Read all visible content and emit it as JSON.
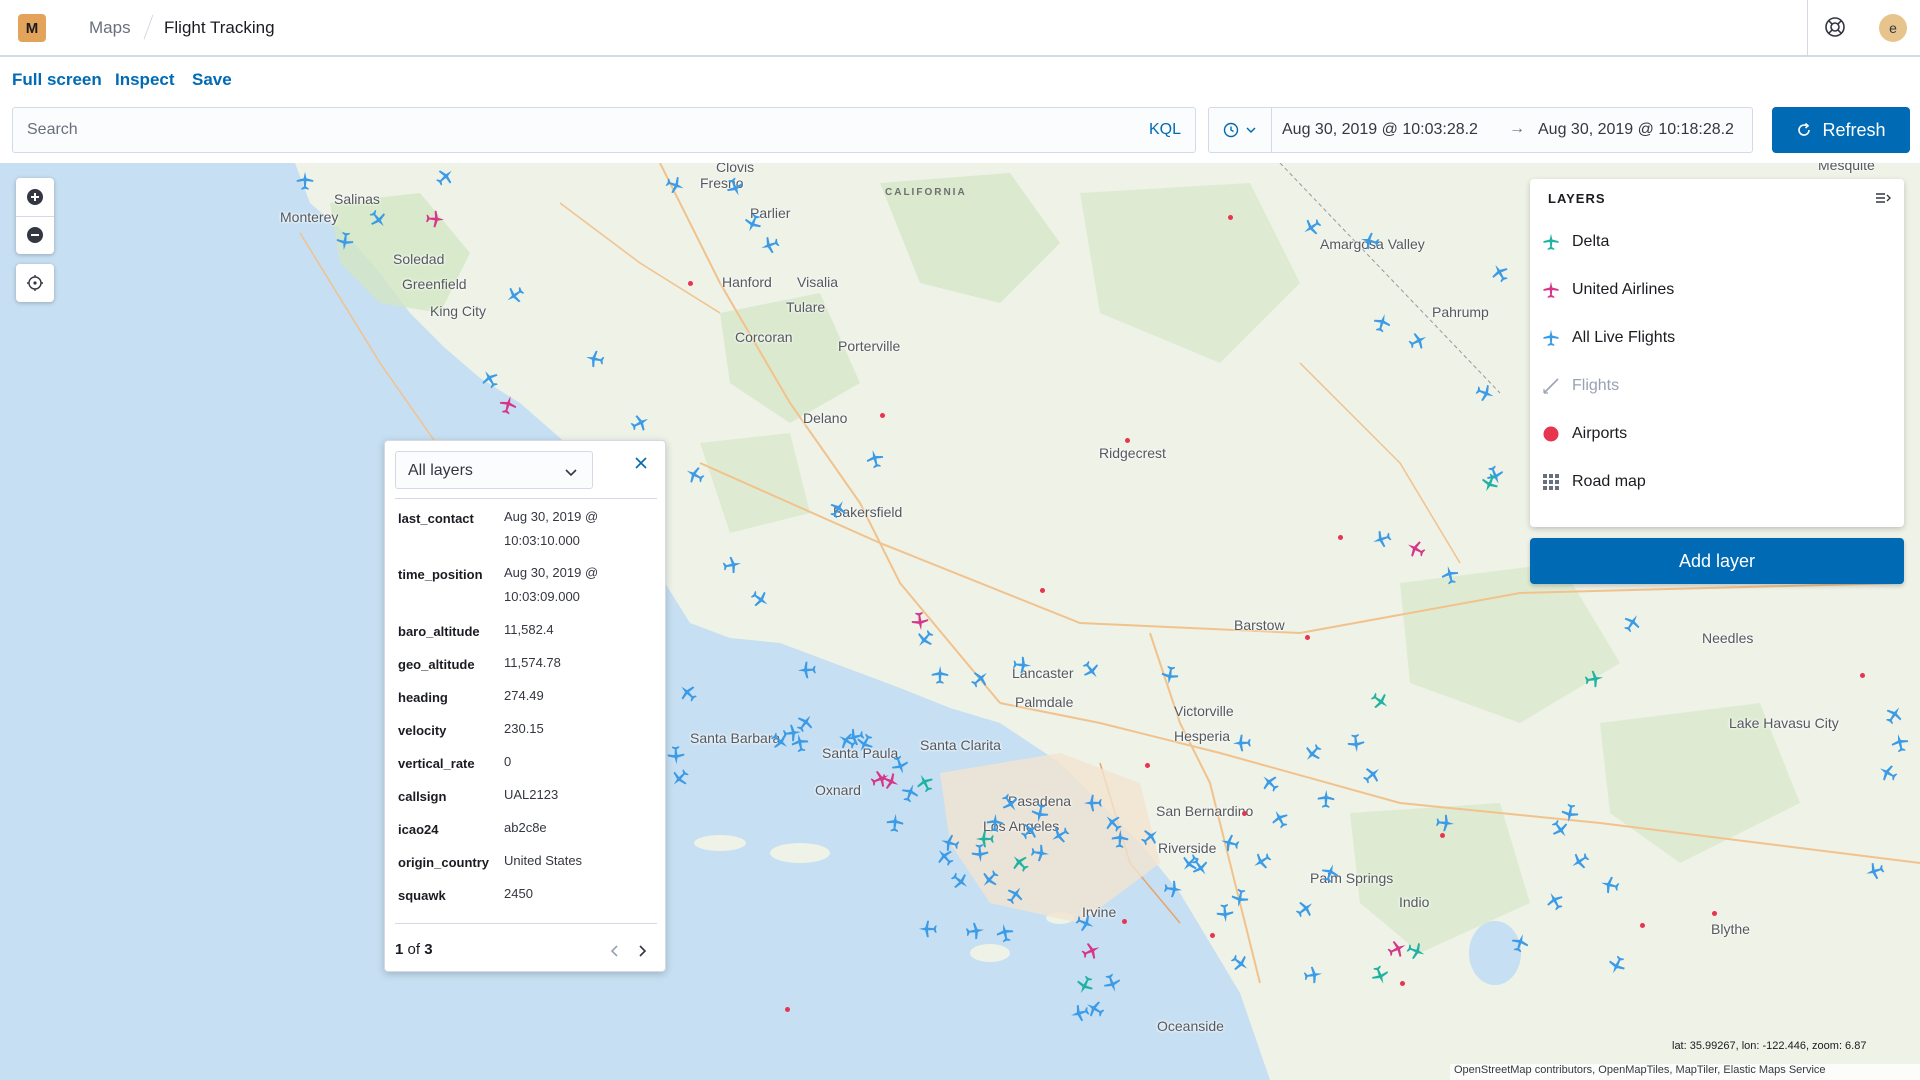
{
  "header": {
    "logo_letter": "M",
    "breadcrumbs": [
      "Maps",
      "Flight Tracking"
    ],
    "user_initial": "e"
  },
  "top_links": {
    "full_screen": "Full screen",
    "inspect": "Inspect",
    "save": "Save"
  },
  "query": {
    "placeholder": "Search",
    "language": "KQL",
    "time_start": "Aug 30, 2019 @ 10:03:28.2",
    "time_arrow": "→",
    "time_end": "Aug 30, 2019 @ 10:18:28.2",
    "refresh_label": "Refresh"
  },
  "colors": {
    "accent": "#006bb4",
    "delta": "#21b2a3",
    "united": "#d6368a",
    "all_live": "#3b9be6",
    "airports": "#e7344f"
  },
  "map_labels": {
    "state": "CALIFORNIA",
    "cities": [
      "Clovis",
      "Fresno",
      "Parlier",
      "Salinas",
      "Monterey",
      "Soledad",
      "Greenfield",
      "King City",
      "Hanford",
      "Visalia",
      "Tulare",
      "Corcoran",
      "Porterville",
      "Delano",
      "Bakersfield",
      "Ridgecrest",
      "Amargosa Valley",
      "Pahrump",
      "Mesquite",
      "Barstow",
      "Lancaster",
      "Palmdale",
      "Victorville",
      "Hesperia",
      "Santa Barbara",
      "Santa Paula",
      "Santa Clarita",
      "Oxnard",
      "Pasadena",
      "Los Angeles",
      "San Bernardino",
      "Riverside",
      "Palm Springs",
      "Indio",
      "Irvine",
      "Oceanside",
      "Needles",
      "Lake Havasu City",
      "Blythe"
    ]
  },
  "tooltip": {
    "layer_select": "All layers",
    "rows": [
      {
        "key": "last_contact",
        "value": "Aug 30, 2019 @ 10:03:10.000"
      },
      {
        "key": "time_position",
        "value": "Aug 30, 2019 @ 10:03:09.000"
      },
      {
        "key": "baro_altitude",
        "value": "11,582.4"
      },
      {
        "key": "geo_altitude",
        "value": "11,574.78"
      },
      {
        "key": "heading",
        "value": "274.49"
      },
      {
        "key": "velocity",
        "value": "230.15"
      },
      {
        "key": "vertical_rate",
        "value": "0"
      },
      {
        "key": "callsign",
        "value": "UAL2123"
      },
      {
        "key": "icao24",
        "value": "ab2c8e"
      },
      {
        "key": "origin_country",
        "value": "United States"
      },
      {
        "key": "squawk",
        "value": "2450"
      }
    ],
    "page_current": "1",
    "page_of": "of",
    "page_total": "3"
  },
  "layers": {
    "title": "LAYERS",
    "items": [
      {
        "label": "Delta",
        "icon": "plane-icon",
        "color": "#21b2a3"
      },
      {
        "label": "United Airlines",
        "icon": "plane-icon",
        "color": "#d6368a"
      },
      {
        "label": "All Live Flights",
        "icon": "plane-icon",
        "color": "#3b9be6"
      },
      {
        "label": "Flights",
        "icon": "line-icon",
        "color": "#98a2b3"
      },
      {
        "label": "Airports",
        "icon": "dot-icon",
        "color": "#e7344f"
      },
      {
        "label": "Road map",
        "icon": "grid-icon",
        "color": "#69707d"
      }
    ],
    "add_label": "Add layer"
  },
  "footer": {
    "coords": "lat: 35.99267, lon: -122.446, zoom: 6.87",
    "attribution": "OpenStreetMap contributors, OpenMapTiles, MapTiler, Elastic Maps Service"
  }
}
